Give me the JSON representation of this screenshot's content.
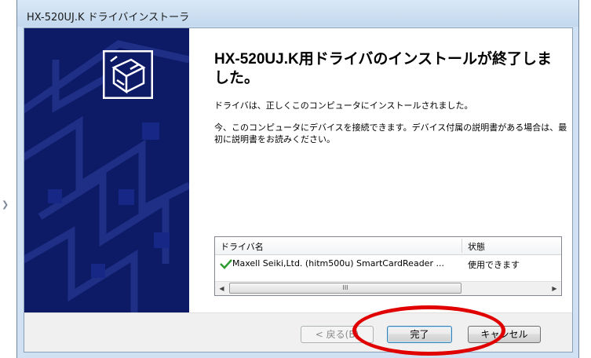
{
  "window": {
    "title": "HX-520UJ.K ドライバインストーラ"
  },
  "content": {
    "heading": "HX-520UJ.K用ドライバのインストールが終了しました。",
    "paragraph1": "ドライバは、正しくこのコンピュータにインストールされました。",
    "paragraph2": "今、このコンピュータにデバイスを接続できます。デバイス付属の説明書がある場合は、最初に説明書をお読みください。"
  },
  "driver_list": {
    "columns": [
      "ドライバ名",
      "状態"
    ],
    "rows": [
      {
        "name": "Maxell Seiki,Ltd. (hitm500u) SmartCardReader ...",
        "status": "使用できます",
        "icon": "checkmark-icon"
      }
    ],
    "scroll_thumb_label": "III"
  },
  "buttons": {
    "back": "< 戻る(B)",
    "finish": "完了",
    "cancel": "キャンセル"
  },
  "colors": {
    "side_panel": "#0d1a66",
    "highlight": "#e00000",
    "check": "#2e9b2e"
  }
}
